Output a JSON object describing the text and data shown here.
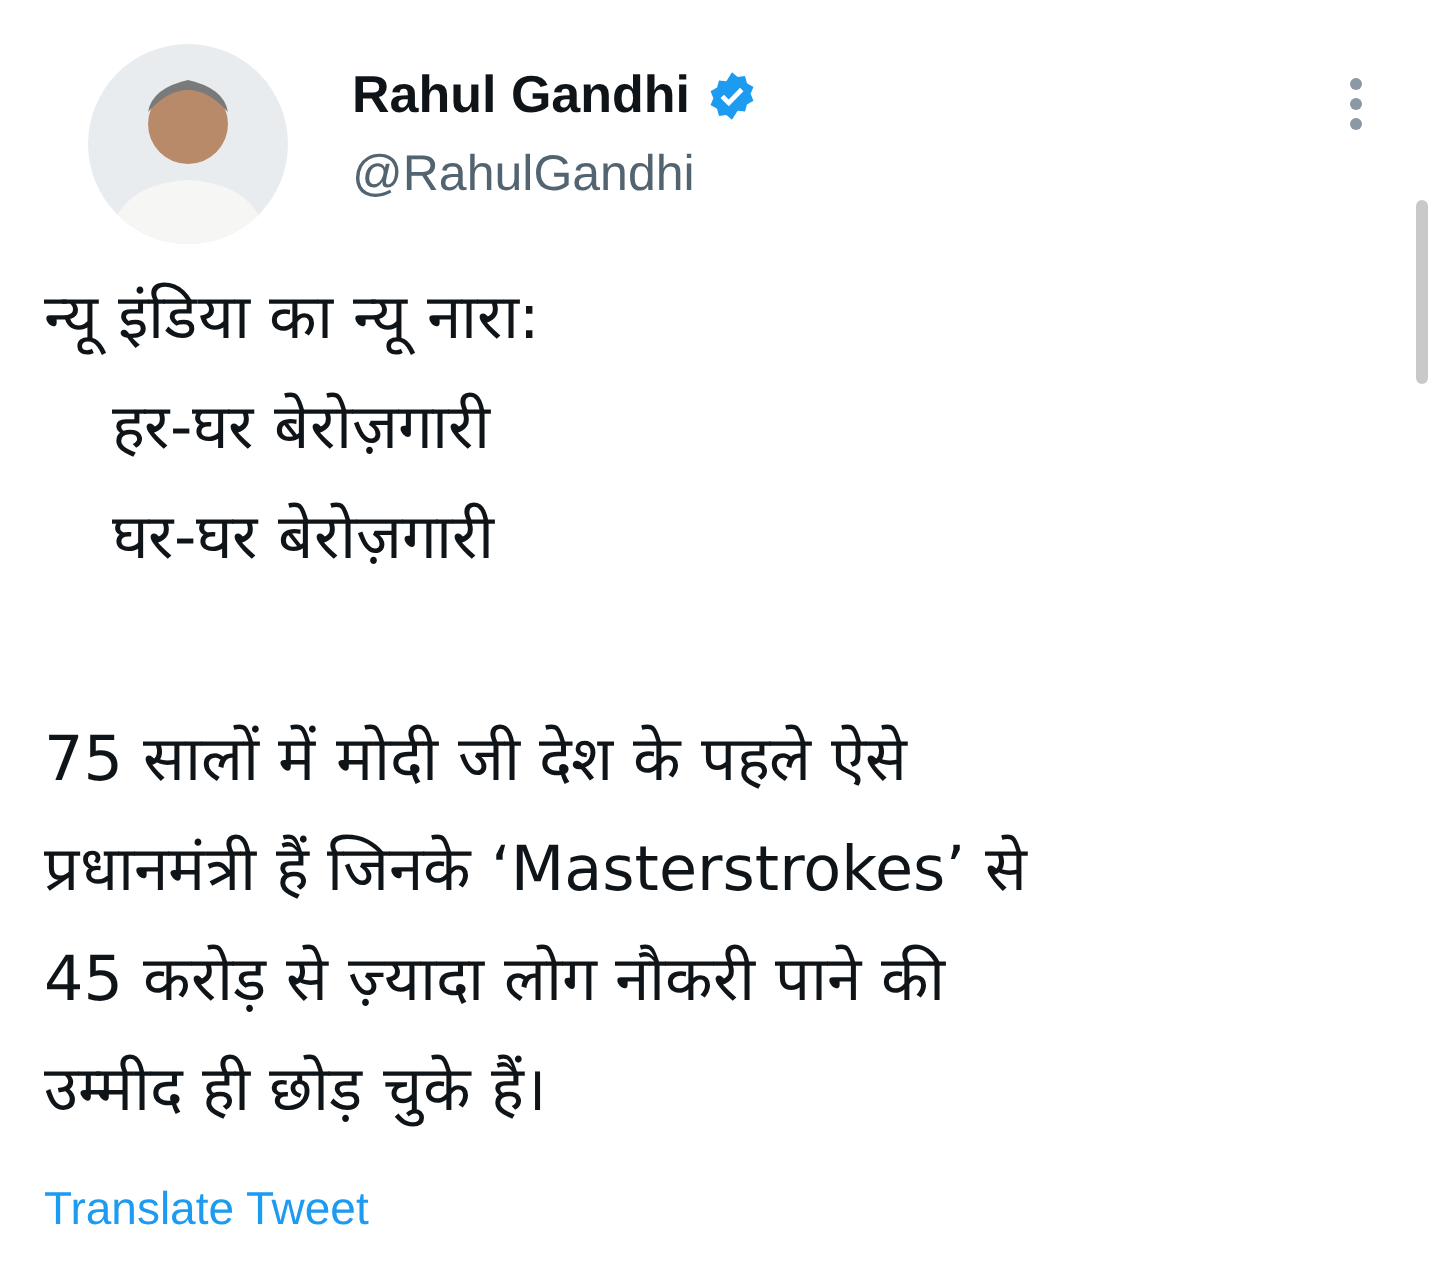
{
  "author": {
    "name": "Rahul Gandhi",
    "handle": "@RahulGandhi",
    "verified": true
  },
  "paragraphs": [
    {
      "lines": [
        {
          "text": "न्यू इंडिया का न्यू नारा:",
          "indent": false
        },
        {
          "text": "हर-घर बेरोज़गारी",
          "indent": true
        },
        {
          "text": "घर-घर बेरोज़गारी",
          "indent": true
        }
      ]
    },
    {
      "lines": [
        {
          "text": "75 सालों में मोदी जी देश के पहले ऐसे",
          "indent": false
        },
        {
          "text": "प्रधानमंत्री हैं जिनके ‘Masterstrokes’ से",
          "indent": false
        },
        {
          "text": "45 करोड़ से ज़्यादा लोग नौकरी पाने की",
          "indent": false
        },
        {
          "text": "उम्मीद ही छोड़ चुके हैं।",
          "indent": false
        }
      ]
    }
  ],
  "translate_link": "Translate Tweet"
}
